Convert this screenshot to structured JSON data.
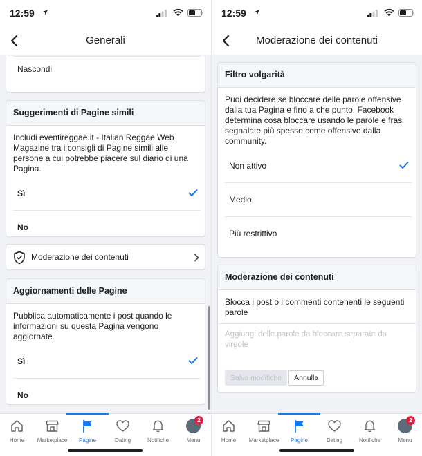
{
  "colors": {
    "accent": "#1877f2",
    "badge": "#e41e3f",
    "background": "#f0f2f5"
  },
  "left": {
    "status": {
      "time": "12:59"
    },
    "navbar": {
      "title": "Generali",
      "back_icon": "chevron-left-icon"
    },
    "top_card": {
      "item": "Nascondi"
    },
    "similar_pages": {
      "header": "Suggerimenti di Pagine simili",
      "description": "Includi eventireggae.it - Italian Reggae Web Magazine tra i consigli di Pagine simili alle persone a cui potrebbe piacere sul diario di una Pagina.",
      "options": [
        "Sì",
        "No"
      ],
      "selected": "Sì"
    },
    "moderation_link": {
      "label": "Moderazione dei contenuti",
      "icon": "shield-icon"
    },
    "page_updates": {
      "header": "Aggiornamenti delle Pagine",
      "description": "Pubblica automaticamente i post quando le informazioni su questa Pagina vengono aggiornate.",
      "options": [
        "Sì",
        "No"
      ],
      "selected": "Sì"
    }
  },
  "right": {
    "status": {
      "time": "12:59"
    },
    "navbar": {
      "title": "Moderazione dei contenuti",
      "back_icon": "chevron-left-icon"
    },
    "profanity_filter": {
      "header": "Filtro volgarità",
      "description": "Puoi decidere se bloccare delle parole offensive dalla tua Pagina e fino a che punto. Facebook determina cosa bloccare usando le parole e frasi segnalate più spesso come offensive dalla community.",
      "options": [
        "Non attivo",
        "Medio",
        "Più restrittivo"
      ],
      "selected": "Non attivo"
    },
    "content_moderation": {
      "header": "Moderazione dei contenuti",
      "description": "Blocca i post o i commenti contenenti le seguenti parole",
      "placeholder": "Aggiungi delle parole da bloccare separate da virgole",
      "save_label": "Salva modifiche",
      "cancel_label": "Annulla"
    }
  },
  "tabbar": {
    "items": [
      {
        "label": "Home",
        "icon": "home-icon"
      },
      {
        "label": "Marketplace",
        "icon": "marketplace-icon"
      },
      {
        "label": "Pagine",
        "icon": "flag-icon"
      },
      {
        "label": "Dating",
        "icon": "heart-icon"
      },
      {
        "label": "Notifiche",
        "icon": "bell-icon"
      },
      {
        "label": "Menu",
        "icon": "avatar"
      }
    ],
    "active": "Pagine",
    "menu_badge": "2"
  }
}
